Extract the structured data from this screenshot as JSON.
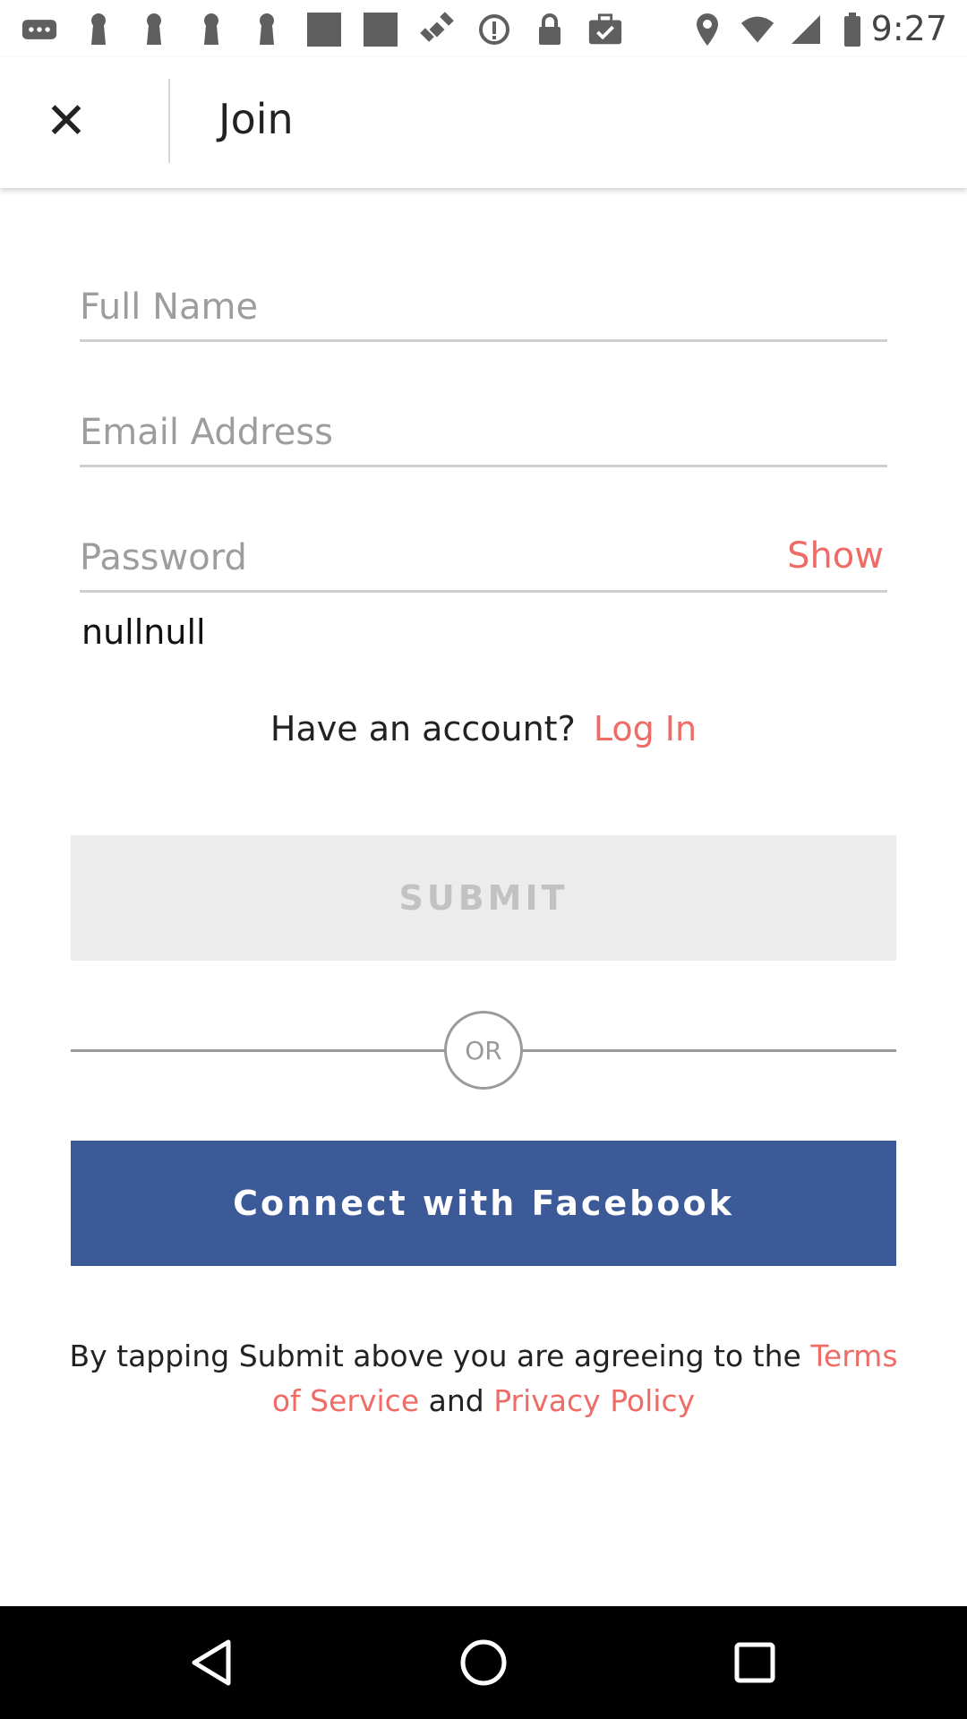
{
  "status_bar": {
    "time": "9:27",
    "icons": [
      "more-icon",
      "keyhole-icon",
      "keyhole-icon",
      "keyhole-icon",
      "keyhole-icon",
      "square-icon",
      "square-icon",
      "satellite-icon",
      "info-icon",
      "lock-icon",
      "briefcase-check-icon",
      "location-icon",
      "wifi-icon",
      "signal-icon",
      "battery-icon"
    ]
  },
  "header": {
    "close_icon": "close-icon",
    "title": "Join"
  },
  "form": {
    "full_name_placeholder": "Full Name",
    "email_placeholder": "Email Address",
    "password_placeholder": "Password",
    "show_label": "Show",
    "null_text": "nullnull"
  },
  "account": {
    "prompt": "Have an account?",
    "login_label": "Log In"
  },
  "submit_label": "SUBMIT",
  "or_label": "OR",
  "facebook_label": "Connect with Facebook",
  "terms": {
    "prefix": "By tapping Submit above you are agreeing to the",
    "terms_link": "Terms of Service",
    "middle": "and",
    "privacy_link": "Privacy Policy"
  },
  "colors": {
    "accent": "#ef6b66",
    "facebook": "#3d5a98",
    "submit_disabled_bg": "#ececec",
    "submit_disabled_text": "#c2c2c2"
  },
  "nav_bar": {
    "icons": [
      "back-icon",
      "home-icon",
      "recents-icon"
    ]
  }
}
